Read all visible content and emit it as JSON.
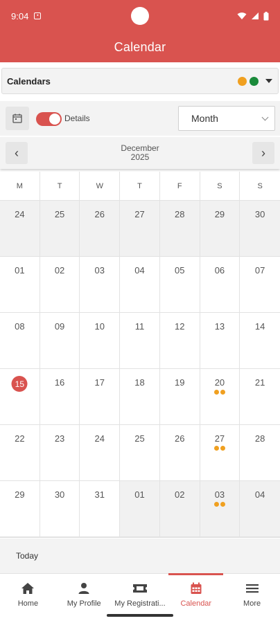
{
  "status_bar": {
    "time": "9:04"
  },
  "app_bar": {
    "title": "Calendar"
  },
  "calendar_selector": {
    "label": "Calendars",
    "dot_colors": [
      "#f0a020",
      "#1a8a3a"
    ]
  },
  "toolbar": {
    "details_label": "Details",
    "details_on": true,
    "view_value": "Month"
  },
  "month_nav": {
    "month": "December",
    "year": "2025",
    "prev_symbol": "‹",
    "next_symbol": "›"
  },
  "weekdays": [
    "M",
    "T",
    "W",
    "T",
    "F",
    "S",
    "S"
  ],
  "days": [
    {
      "n": "24",
      "other": true
    },
    {
      "n": "25",
      "other": true
    },
    {
      "n": "26",
      "other": true
    },
    {
      "n": "27",
      "other": true
    },
    {
      "n": "28",
      "other": true
    },
    {
      "n": "29",
      "other": true
    },
    {
      "n": "30",
      "other": true
    },
    {
      "n": "01"
    },
    {
      "n": "02"
    },
    {
      "n": "03"
    },
    {
      "n": "04"
    },
    {
      "n": "05"
    },
    {
      "n": "06"
    },
    {
      "n": "07"
    },
    {
      "n": "08"
    },
    {
      "n": "09"
    },
    {
      "n": "10"
    },
    {
      "n": "11"
    },
    {
      "n": "12"
    },
    {
      "n": "13"
    },
    {
      "n": "14"
    },
    {
      "n": "15",
      "today": true
    },
    {
      "n": "16"
    },
    {
      "n": "17"
    },
    {
      "n": "18"
    },
    {
      "n": "19"
    },
    {
      "n": "20",
      "events": 2
    },
    {
      "n": "21"
    },
    {
      "n": "22"
    },
    {
      "n": "23"
    },
    {
      "n": "24"
    },
    {
      "n": "25"
    },
    {
      "n": "26"
    },
    {
      "n": "27",
      "events": 2
    },
    {
      "n": "28"
    },
    {
      "n": "29"
    },
    {
      "n": "30"
    },
    {
      "n": "31"
    },
    {
      "n": "01",
      "other": true
    },
    {
      "n": "02",
      "other": true
    },
    {
      "n": "03",
      "other": true,
      "events": 2
    },
    {
      "n": "04",
      "other": true
    }
  ],
  "today_button": {
    "label": "Today"
  },
  "bottom_nav": {
    "items": [
      {
        "label": "Home",
        "icon": "home-icon"
      },
      {
        "label": "My Profile",
        "icon": "person-icon"
      },
      {
        "label": "My Registrati...",
        "icon": "ticket-icon"
      },
      {
        "label": "Calendar",
        "icon": "calendar-icon",
        "active": true
      },
      {
        "label": "More",
        "icon": "menu-icon"
      }
    ]
  },
  "colors": {
    "brand": "#d9534f",
    "event_dot": "#f0a020"
  }
}
